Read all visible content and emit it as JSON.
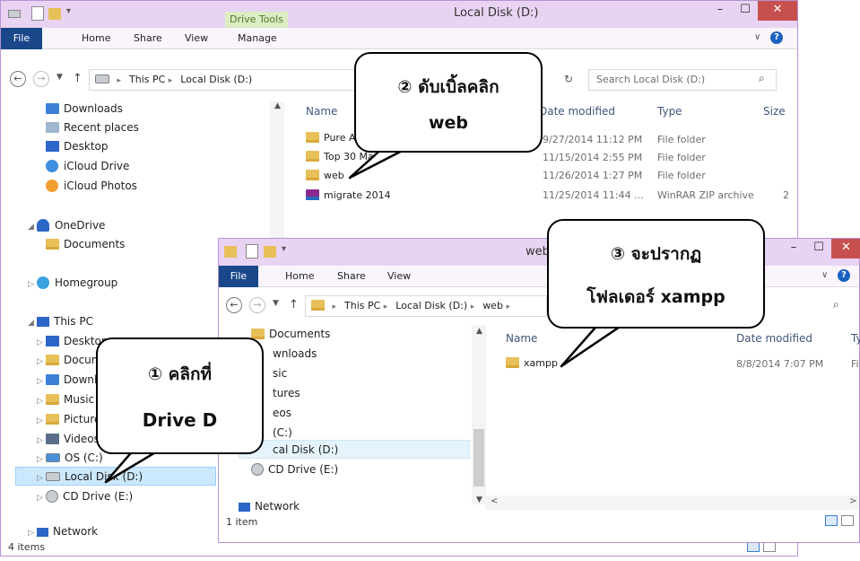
{
  "back_window": {
    "title": "Local Disk (D:)",
    "context_tab": "Drive Tools",
    "ribbon_tabs": [
      "File",
      "Home",
      "Share",
      "View",
      "Manage"
    ],
    "address": [
      "This PC",
      "Local Disk (D:)"
    ],
    "search_placeholder": "Search Local Disk (D:)",
    "columns": [
      "Name",
      "Date modified",
      "Type",
      "Size"
    ],
    "files": [
      {
        "name": "Pure A",
        "date": "9/27/2014 11:12 PM",
        "type": "File folder",
        "size": ""
      },
      {
        "name": "Top 30 Ma",
        "date": "11/15/2014 2:55 PM",
        "type": "File folder",
        "size": ""
      },
      {
        "name": "web",
        "date": "11/26/2014 1:27 PM",
        "type": "File folder",
        "size": ""
      },
      {
        "name": "migrate 2014",
        "date": "11/25/2014 11:44 ...",
        "type": "WinRAR ZIP archive",
        "size": "2"
      }
    ],
    "nav": {
      "quick": [
        "Downloads",
        "Recent places",
        "Desktop",
        "iCloud Drive",
        "iCloud Photos"
      ],
      "onedrive": "OneDrive",
      "onedrive_children": [
        "Documents"
      ],
      "homegroup": "Homegroup",
      "thispc": "This PC",
      "thispc_children": [
        "Desktop",
        "Documents",
        "Downloads",
        "Music",
        "Pictures",
        "Videos",
        "OS (C:)",
        "Local Disk (D:)",
        "CD Drive (E:)"
      ],
      "network": "Network"
    },
    "status": "4 items"
  },
  "front_window": {
    "title": "web",
    "ribbon_tabs": [
      "File",
      "Home",
      "Share",
      "View"
    ],
    "address": [
      "This PC",
      "Local Disk (D:)",
      "web"
    ],
    "columns": [
      "Name",
      "Date modified",
      "Ty"
    ],
    "files": [
      {
        "name": "xampp",
        "date": "8/8/2014 7:07 PM",
        "type": "File"
      }
    ],
    "nav": [
      "Documents",
      "wnloads",
      "sic",
      "tures",
      "eos",
      "(C:)",
      "cal Disk (D:)",
      "CD Drive (E:)",
      "Network"
    ],
    "status": "1 item"
  },
  "callouts": {
    "c1_line1": "① คลิกที่",
    "c1_line2": "Drive D",
    "c2_line1": "② ดับเบิ้ลคลิก",
    "c2_line2": "web",
    "c3_line1": "③ จะปรากฏ",
    "c3_line2": "โฟลเดอร์ xampp"
  },
  "colors": {
    "title_bar": "#e9d3f2",
    "file_tab": "#19478a",
    "close_button": "#c7504f",
    "selection": "#cce8ff"
  }
}
